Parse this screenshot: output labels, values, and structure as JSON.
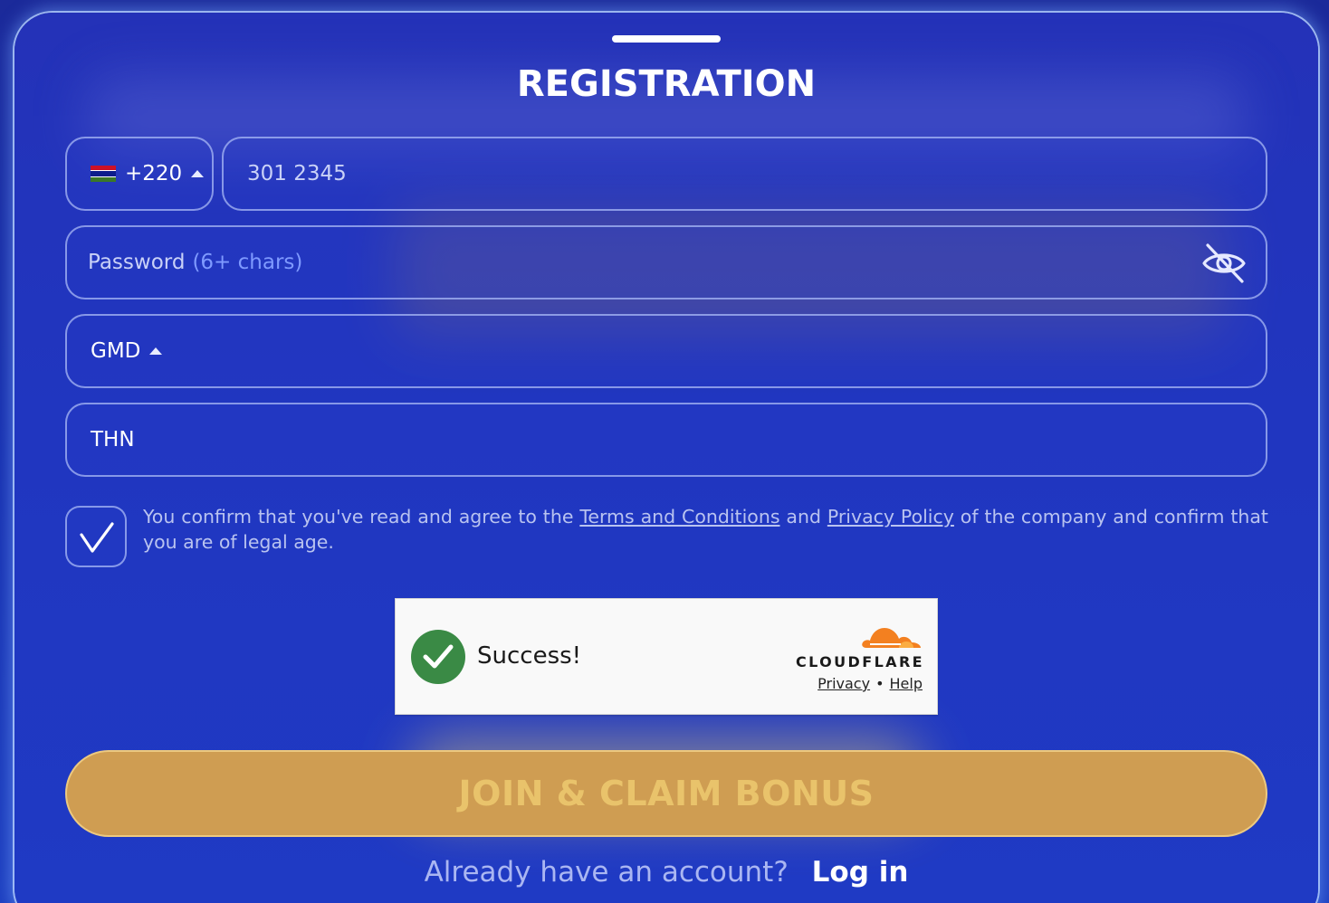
{
  "registration": {
    "title": "REGISTRATION"
  },
  "phone": {
    "country_code": "+220",
    "flag_colors": [
      "#ce1126",
      "#ffffff",
      "#0c1c8c",
      "#ffffff",
      "#3a7728"
    ],
    "placeholder": "301 2345"
  },
  "password": {
    "label": "Password",
    "hint": "(6+ chars)",
    "toggle_icon": "eye-slash-icon"
  },
  "currency": {
    "value": "GMD"
  },
  "promo": {
    "value": "THN"
  },
  "consent": {
    "checked": true,
    "text_before": "You confirm that you've read and agree to the",
    "terms_link": "Terms and Conditions",
    "text_and": "and",
    "privacy_link": "Privacy Policy",
    "text_after": "of the company and confirm that you are of legal age."
  },
  "captcha": {
    "status": "Success!",
    "provider": "CLOUDFLARE",
    "privacy_link": "Privacy",
    "separator": "•",
    "help_link": "Help"
  },
  "cta": {
    "label": "JOIN & CLAIM BONUS"
  },
  "footer": {
    "question": "Already have an account?",
    "login_label": "Log in"
  },
  "colors": {
    "panel_bg": "#2036c0",
    "button_bg": "#cf9d52",
    "button_text": "#e9c36b",
    "link_hint": "#7f9aff",
    "success_green": "#3a8a45",
    "cloudflare_orange": "#f38020"
  }
}
